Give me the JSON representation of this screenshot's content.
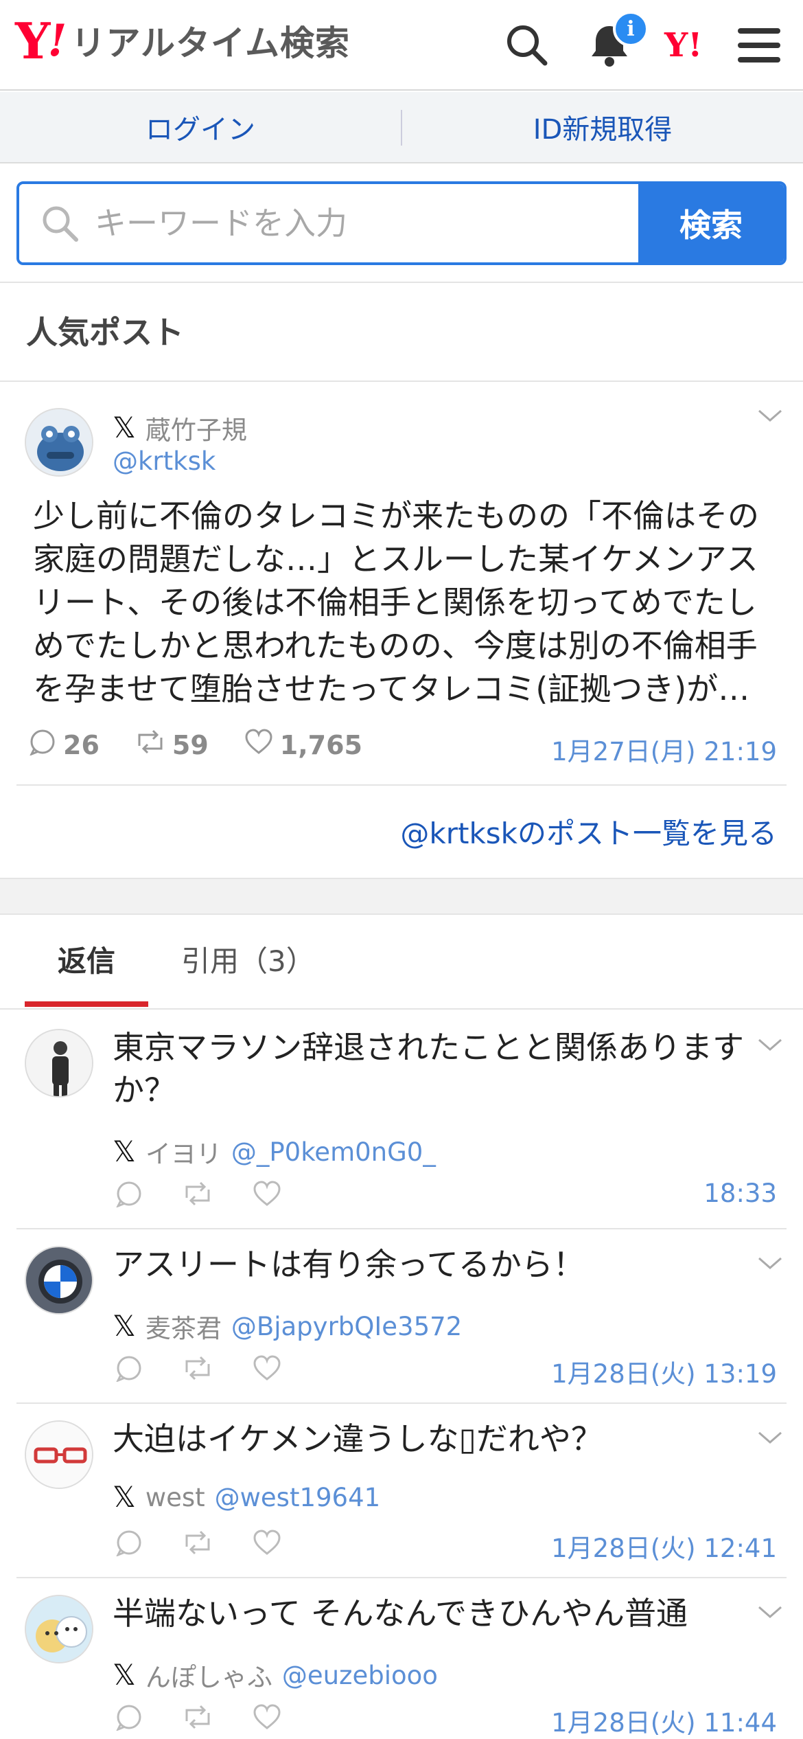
{
  "header": {
    "logo_y": "Y",
    "logo_ex": "!",
    "logo_text": "リアルタイム検索",
    "notification_badge": "i",
    "yahoo_mini": "Y!"
  },
  "loginbar": {
    "login": "ログイン",
    "register": "ID新規取得"
  },
  "search": {
    "placeholder": "キーワードを入力",
    "button": "検索"
  },
  "section_title": "人気ポスト",
  "post": {
    "name": "蔵竹子規",
    "handle": "@krtksk",
    "text": "少し前に不倫のタレコミが来たものの「不倫はその家庭の問題だしな…」とスルーした某イケメンアスリート、その後は不倫相手と関係を切ってめでたしめでたしかと思われたものの、今度は別の不倫相手を孕ませて堕胎させたってタレコミ(証拠つき)が…",
    "replies": "26",
    "reposts": "59",
    "likes": "1,765",
    "date": "1月27日(月) 21:19",
    "more_link": "@krtkskのポスト一覧を見る"
  },
  "tabs": {
    "reply": "返信",
    "quote": "引用（3）"
  },
  "replies": [
    {
      "text": "東京マラソン辞退されたことと関係ありますか？",
      "name": "イヨリ",
      "handle": "@_P0kem0nG0_",
      "date": "18:33"
    },
    {
      "text": "アスリートは有り余ってるから！",
      "name": "麦茶君",
      "handle": "@BjapyrbQIe3572",
      "date": "1月28日(火) 13:19"
    },
    {
      "text": "大迫はイケメン違うしな▯だれや？",
      "name": "west",
      "handle": "@west19641",
      "date": "1月28日(火) 12:41"
    },
    {
      "text": "半端ないって そんなんできひんやん普通",
      "name": "んぽしゃふ",
      "handle": "@euzebiooo",
      "date": "1月28日(火) 11:44"
    }
  ],
  "colors": {
    "accent": "#2a7ae2",
    "brand": "#ff0033",
    "link": "#1a56b8",
    "tab_underline": "#d9262c"
  }
}
